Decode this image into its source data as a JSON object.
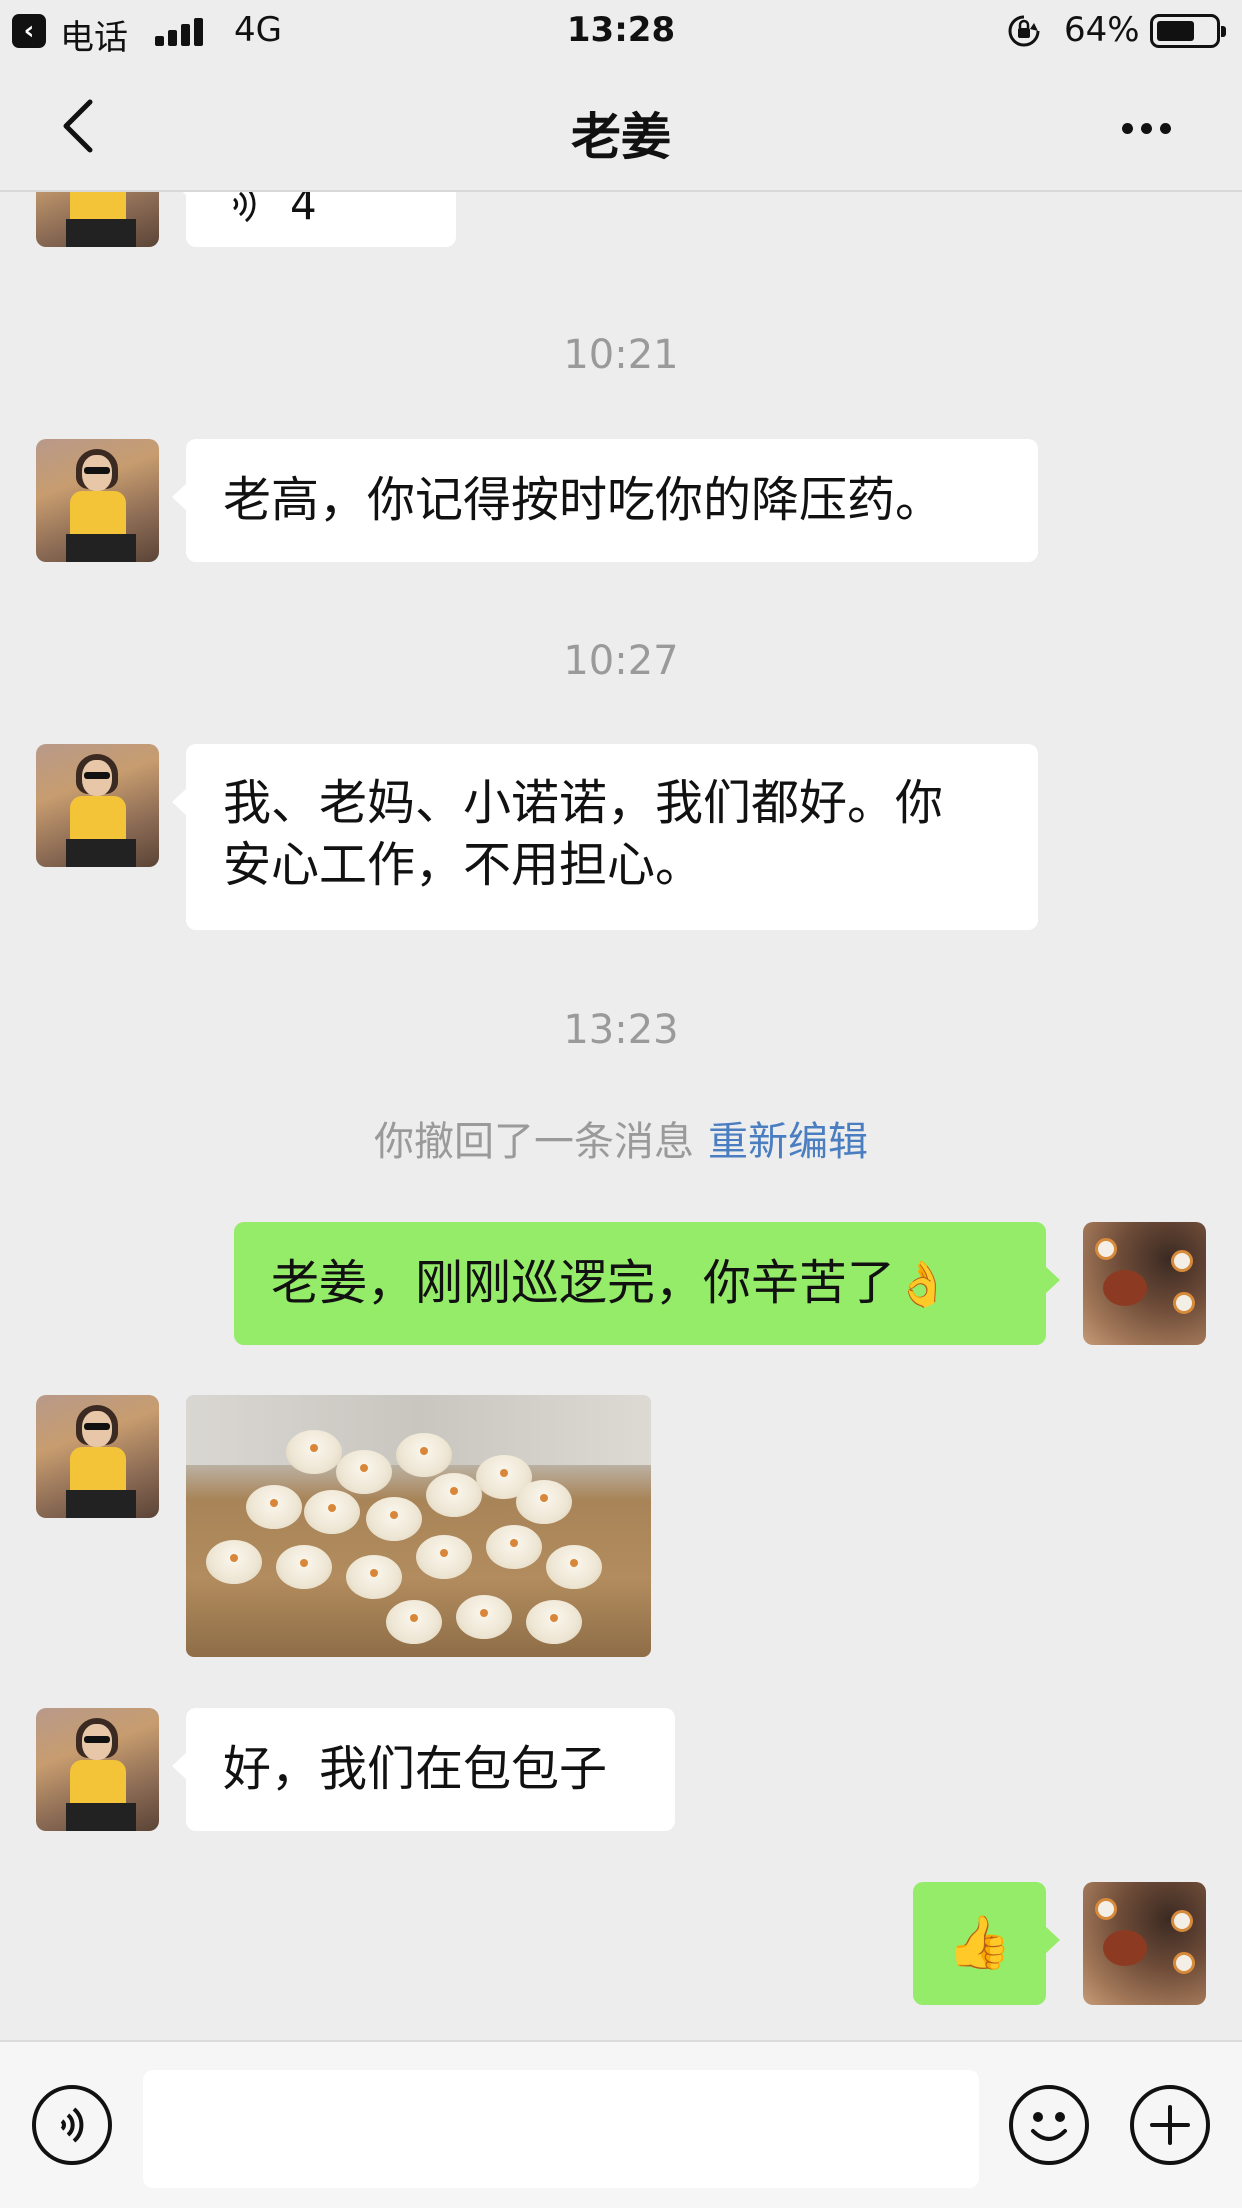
{
  "status_bar": {
    "back_app": "电话",
    "network": "4G",
    "time": "13:28",
    "battery_percent": "64%",
    "battery_level": 0.64
  },
  "nav": {
    "title": "老姜",
    "back_icon": "chevron-left-icon",
    "more_icon": "more-dots-icon"
  },
  "messages": {
    "voice_duration": "4",
    "ts1": "10:21",
    "msg1": "老高，你记得按时吃你的降压药。",
    "ts2": "10:27",
    "msg2_line1": "我、老妈、小诺诺，我们都好。你",
    "msg2_line2": "安心工作，不用担心。",
    "ts3": "13:23",
    "recall_text": "你撤回了一条消息",
    "recall_edit": "重新编辑",
    "msg3": "老姜，刚刚巡逻完，你辛苦了",
    "msg3_emoji": "👌",
    "photo_desc_icon": "steamed-buns-photo",
    "msg4": "好，我们在包包子",
    "msg5_emoji": "👍"
  },
  "input_bar": {
    "voice_icon": "voice-mode-icon",
    "emoji_icon": "emoji-icon",
    "plus_icon": "plus-icon",
    "text_value": ""
  },
  "colors": {
    "background": "#ededed",
    "outgoing_bubble": "#95ec69",
    "incoming_bubble": "#ffffff",
    "link": "#4a7ec0",
    "timestamp": "#9a9a9a"
  }
}
